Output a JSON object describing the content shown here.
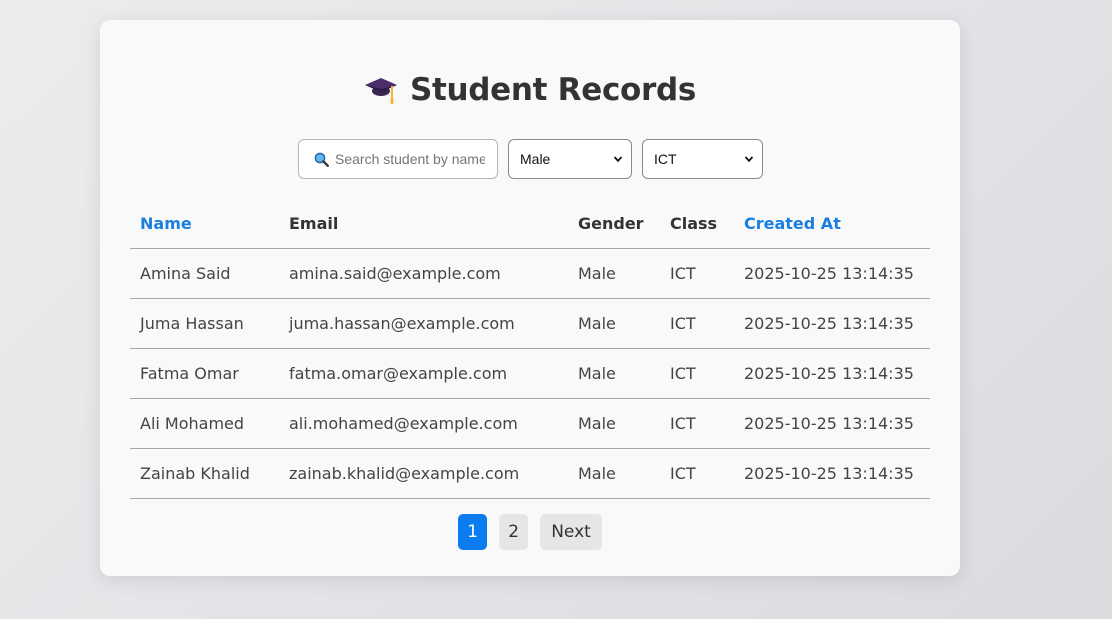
{
  "title": "Student Records",
  "search": {
    "placeholder": "Search student by name",
    "value": ""
  },
  "filters": {
    "gender": {
      "selected": "Male"
    },
    "class": {
      "selected": "ICT"
    }
  },
  "table": {
    "columns": [
      "Name",
      "Email",
      "Gender",
      "Class",
      "Created At"
    ],
    "sortable_columns": [
      "Name",
      "Created At"
    ],
    "rows": [
      [
        "Amina Said",
        "amina.said@example.com",
        "Male",
        "ICT",
        "2025-10-25 13:14:35"
      ],
      [
        "Juma Hassan",
        "juma.hassan@example.com",
        "Male",
        "ICT",
        "2025-10-25 13:14:35"
      ],
      [
        "Fatma Omar",
        "fatma.omar@example.com",
        "Male",
        "ICT",
        "2025-10-25 13:14:35"
      ],
      [
        "Ali Mohamed",
        "ali.mohamed@example.com",
        "Male",
        "ICT",
        "2025-10-25 13:14:35"
      ],
      [
        "Zainab Khalid",
        "zainab.khalid@example.com",
        "Male",
        "ICT",
        "2025-10-25 13:14:35"
      ]
    ]
  },
  "pagination": {
    "pages": [
      "1",
      "2"
    ],
    "current": "1",
    "next_label": "Next"
  },
  "colors": {
    "accent": "#0a7cf0",
    "sort_header": "#1a7fe0",
    "card_bg": "#f9f9f9"
  },
  "icons": {
    "title": "graduation-cap-icon",
    "search": "magnifier-icon"
  }
}
